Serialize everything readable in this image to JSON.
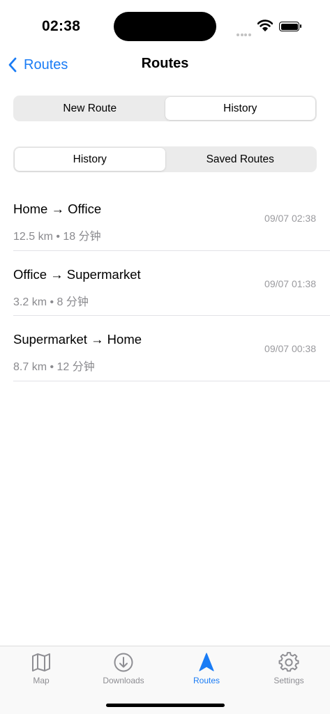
{
  "status_bar": {
    "time": "02:38"
  },
  "nav": {
    "back_label": "Routes",
    "title": "Routes"
  },
  "mode_tabs": {
    "items": [
      "New Route",
      "History"
    ],
    "selected": "History"
  },
  "history_tabs": {
    "items": [
      "History",
      "Saved Routes"
    ],
    "selected": "History"
  },
  "routes": [
    {
      "name": "Home → Office",
      "meta": "12.5 km • 18 分钟",
      "time": "09/07 02:38"
    },
    {
      "name": "Office → Supermarket",
      "meta": "3.2 km • 8 分钟",
      "time": "09/07 01:38"
    },
    {
      "name": "Supermarket → Home",
      "meta": "8.7 km • 12 分钟",
      "time": "09/07 00:38"
    }
  ],
  "tab_bar": {
    "items": [
      {
        "label": "Map",
        "icon": "map-icon"
      },
      {
        "label": "Downloads",
        "icon": "download-icon"
      },
      {
        "label": "Routes",
        "icon": "navigation-arrow-icon"
      },
      {
        "label": "Settings",
        "icon": "gear-icon"
      }
    ],
    "selected": "Routes"
  },
  "colors": {
    "accent": "#1a7cf5",
    "inactive": "#8e8e93",
    "secondary_text": "#8a8a8e"
  }
}
